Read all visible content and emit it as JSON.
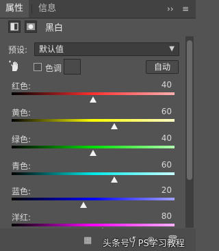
{
  "tabs": {
    "properties": "属性",
    "info": "信息"
  },
  "topbar": {
    "collapse": "››",
    "menu": "≡"
  },
  "header": {
    "title": "黑白",
    "adjust_icon": "adjustment-layer-icon",
    "mask_icon": "layer-mask-icon"
  },
  "preset": {
    "label": "预设:",
    "value": "默认值"
  },
  "tint": {
    "label": "色调",
    "checked": false
  },
  "auto_button": "自动",
  "sliders": [
    {
      "label": "红色:",
      "value": "40",
      "gradient": [
        "#000000",
        "#ff3030",
        "#ffb0b0"
      ],
      "position": 0.5
    },
    {
      "label": "黄色:",
      "value": "60",
      "gradient": [
        "#000000",
        "#ffff00",
        "#ffffc8"
      ],
      "position": 0.63
    },
    {
      "label": "绿色:",
      "value": "40",
      "gradient": [
        "#000000",
        "#00e000",
        "#b0ffb0"
      ],
      "position": 0.5
    },
    {
      "label": "青色:",
      "value": "60",
      "gradient": [
        "#000000",
        "#00e8e8",
        "#c8ffff"
      ],
      "position": 0.63
    },
    {
      "label": "蓝色:",
      "value": "20",
      "gradient": [
        "#000000",
        "#0000ff",
        "#a0a0ff"
      ],
      "position": 0.44
    },
    {
      "label": "洋红:",
      "value": "80",
      "gradient": [
        "#000000",
        "#ff00ff",
        "#ffb0ff"
      ],
      "position": 0.56
    }
  ],
  "watermark": "头条号 / PS学习教程"
}
